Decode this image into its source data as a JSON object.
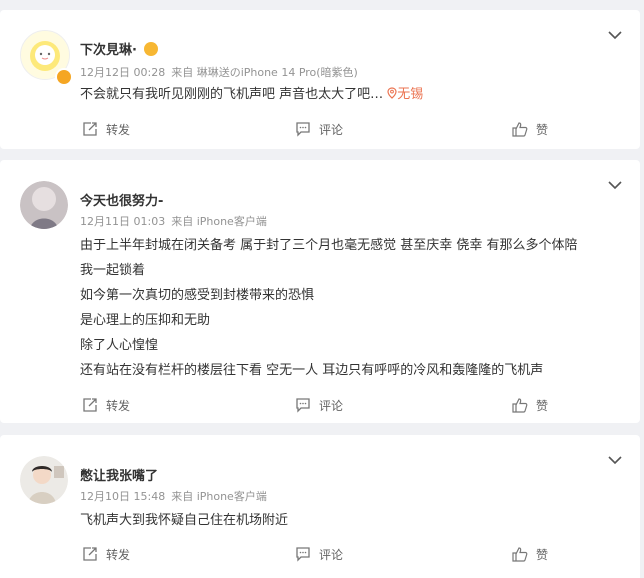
{
  "comments": [
    {
      "user": "下次見琳·",
      "date": "12月12日 00:28",
      "source": "来自 琳琳送のiPhone 14 Pro(暗紫色)",
      "lines": [
        "不会就只有我听见刚刚的飞机声吧 声音也太大了吧…"
      ],
      "location": "无锡",
      "actions": {
        "repost": "转发",
        "comment": "评论",
        "like": "赞"
      }
    },
    {
      "user": "今天也很努力-",
      "date": "12月11日 01:03",
      "source": "来自 iPhone客户端",
      "lines": [
        "由于上半年封城在闭关备考 属于封了三个月也毫无感觉 甚至庆幸 侥幸 有那么多个体陪",
        "我一起锁着",
        "如今第一次真切的感受到封楼带来的恐惧",
        "是心理上的压抑和无助",
        "除了人心惶惶",
        "还有站在没有栏杆的楼层往下看 空无一人 耳边只有呼呼的冷风和轰隆隆的飞机声"
      ],
      "actions": {
        "repost": "转发",
        "comment": "评论",
        "like": "赞"
      }
    },
    {
      "user": "憋让我张嘴了",
      "date": "12月10日 15:48",
      "source": "来自 iPhone客户端",
      "lines": [
        "飞机声大到我怀疑自己住在机场附近"
      ],
      "actions": {
        "repost": "转发",
        "comment": "评论",
        "like": "赞"
      }
    }
  ],
  "colors": {
    "accent": "#eb7350",
    "meta": "#939393",
    "vip": "#f5a623"
  }
}
